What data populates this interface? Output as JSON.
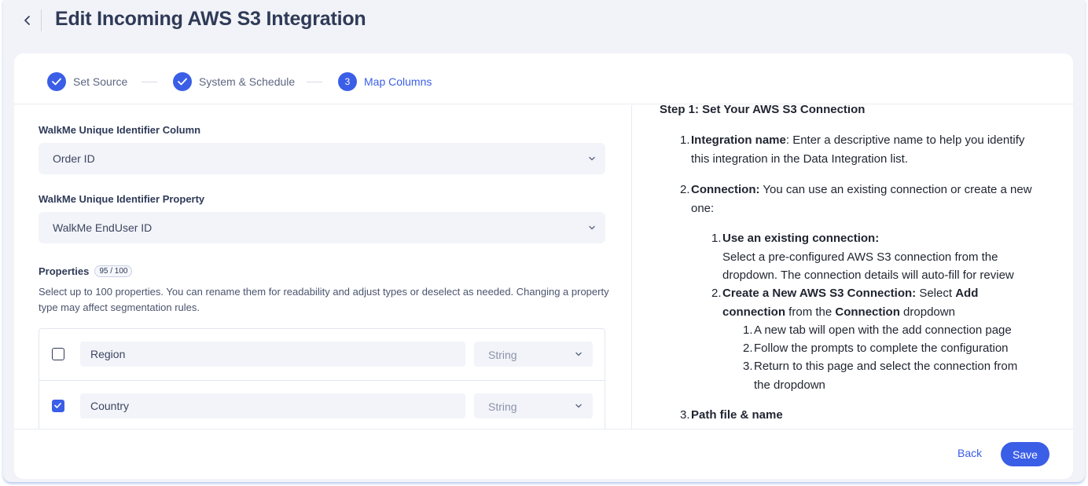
{
  "header": {
    "title": "Edit Incoming AWS S3 Integration",
    "back_icon": "chevron-left-icon"
  },
  "stepper": {
    "steps": [
      {
        "label": "Set Source",
        "state": "complete",
        "icon": "check-icon"
      },
      {
        "label": "System & Schedule",
        "state": "complete",
        "icon": "check-icon"
      },
      {
        "label": "Map Columns",
        "state": "active",
        "number": "3"
      }
    ]
  },
  "form": {
    "identifier_column": {
      "label": "WalkMe Unique Identifier Column",
      "value": "Order ID"
    },
    "identifier_property": {
      "label": "WalkMe Unique Identifier Property",
      "value": "WalkMe EndUser ID"
    },
    "properties": {
      "label": "Properties",
      "count_badge": "95 / 100",
      "description": "Select up to 100 properties. You can rename them for readability and adjust types or deselect as needed. Changing a property type may affect segmentation rules.",
      "rows": [
        {
          "name": "Region",
          "type": "String",
          "checked": false
        },
        {
          "name": "Country",
          "type": "String",
          "checked": true
        }
      ]
    }
  },
  "guide": {
    "heading": "Step 1: Set Your AWS S3 Connection",
    "item1": {
      "num": "1.",
      "bold": "Integration name",
      "text_line1": ": Enter a descriptive name to help you identify",
      "text_line2": "this integration in the Data Integration list."
    },
    "item2": {
      "num": "2.",
      "bold": "Connection:",
      "text_line1": " You can use an existing connection or create a new",
      "text_line2": "one:"
    },
    "item2_1": {
      "num": "1.",
      "bold": "Use an existing connection:",
      "line2": "Select a pre-configured AWS S3 connection from the",
      "line3": "dropdown. The connection details will auto-fill for review"
    },
    "item2_2": {
      "num": "2.",
      "bold": "Create a New AWS S3 Connection:",
      "text1": " Select ",
      "bold2": "Add",
      "bold3": "connection",
      "text2": " from the ",
      "bold4": "Connection",
      "text3": " dropdown"
    },
    "sub": [
      {
        "num": "1.",
        "text": "A new tab will open with the add connection page"
      },
      {
        "num": "2.",
        "text": "Follow the prompts to complete the configuration"
      },
      {
        "num": "3.",
        "text": "Return to this page and select the connection from",
        "text2": "the dropdown"
      }
    ],
    "item3": {
      "num": "3.",
      "bold": "Path file & name"
    }
  },
  "footer": {
    "back_label": "Back",
    "save_label": "Save"
  },
  "colors": {
    "accent": "#3b5ee7",
    "title": "#2f3a57",
    "background": "#f1f3f8"
  }
}
